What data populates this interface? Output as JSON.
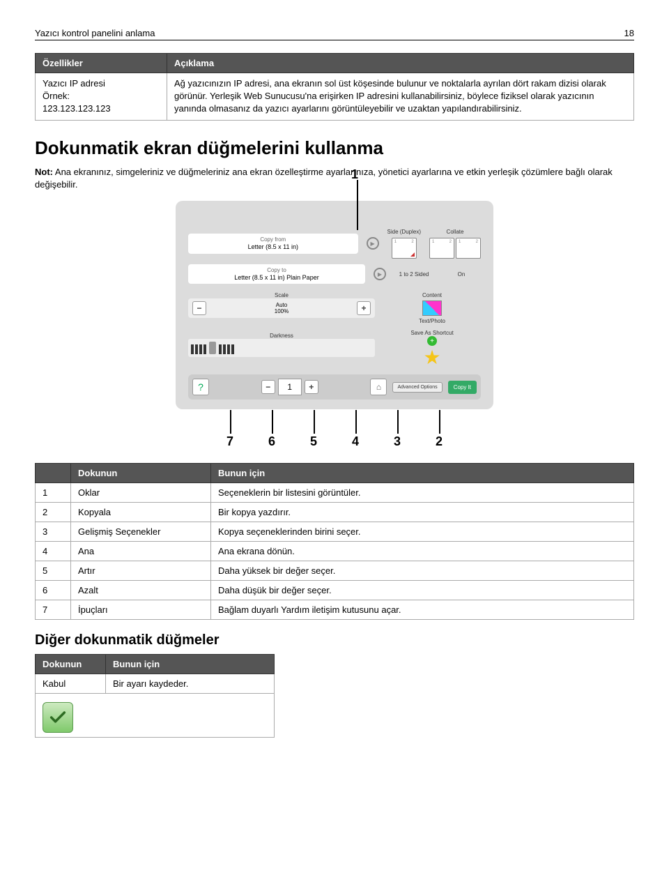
{
  "header": {
    "title": "Yazıcı kontrol panelini anlama",
    "page": "18"
  },
  "spec_table": {
    "headers": [
      "Özellikler",
      "Açıklama"
    ],
    "feature_label": "Yazıcı IP adresi",
    "example_label": "Örnek:",
    "example_value": "123.123.123.123",
    "description": "Ağ yazıcınızın IP adresi, ana ekranın sol üst köşesinde bulunur ve noktalarla ayrılan dört rakam dizisi olarak görünür. Yerleşik Web Sunucusu'na erişirken IP adresini kullanabilirsiniz, böylece fiziksel olarak yazıcının yanında olmasanız da yazıcı ayarlarını görüntüleyebilir ve uzaktan yapılandırabilirsiniz."
  },
  "touchscreen": {
    "heading": "Dokunmatik ekran düğmelerini kullanma",
    "note_prefix": "Not:",
    "note_body": " Ana ekranınız, simgeleriniz ve düğmeleriniz ana ekran özelleştirme ayarlarınıza, yönetici ayarlarına ve etkin yerleşik çözümlere bağlı olarak değişebilir."
  },
  "panel": {
    "callout1": "1",
    "copy_from_label": "Copy from",
    "copy_from_value": "Letter (8.5 x 11 in)",
    "copy_to_label": "Copy to",
    "copy_to_value": "Letter (8.5 x 11 in) Plain Paper",
    "side_label": "Side (Duplex)",
    "side_value": "1 to 2 Sided",
    "collate_label": "Collate",
    "collate_value": "On",
    "scale_label": "Scale",
    "scale_mode": "Auto",
    "scale_value": "100%",
    "content_label": "Content",
    "content_value": "Text/Photo",
    "darkness_label": "Darkness",
    "save_label": "Save As Shortcut",
    "count": "1",
    "advanced": "Advanced Options",
    "copyit": "Copy It",
    "callouts_bottom": [
      "7",
      "6",
      "5",
      "4",
      "3",
      "2"
    ]
  },
  "actions_table": {
    "headers": [
      "",
      "Dokunun",
      "Bunun için"
    ],
    "rows": [
      {
        "n": "1",
        "name": "Oklar",
        "desc": "Seçeneklerin bir listesini görüntüler."
      },
      {
        "n": "2",
        "name": "Kopyala",
        "desc": "Bir kopya yazdırır."
      },
      {
        "n": "3",
        "name": "Gelişmiş Seçenekler",
        "desc": "Kopya seçeneklerinden birini seçer."
      },
      {
        "n": "4",
        "name": "Ana",
        "desc": "Ana ekrana dönün."
      },
      {
        "n": "5",
        "name": "Artır",
        "desc": "Daha yüksek bir değer seçer."
      },
      {
        "n": "6",
        "name": "Azalt",
        "desc": "Daha düşük bir değer seçer."
      },
      {
        "n": "7",
        "name": "İpuçları",
        "desc": "Bağlam duyarlı Yardım iletişim kutusunu açar."
      }
    ]
  },
  "other_buttons": {
    "heading": "Diğer dokunmatik düğmeler",
    "headers": [
      "Dokunun",
      "Bunun için"
    ],
    "row_name": "Kabul",
    "row_desc": "Bir ayarı kaydeder."
  }
}
